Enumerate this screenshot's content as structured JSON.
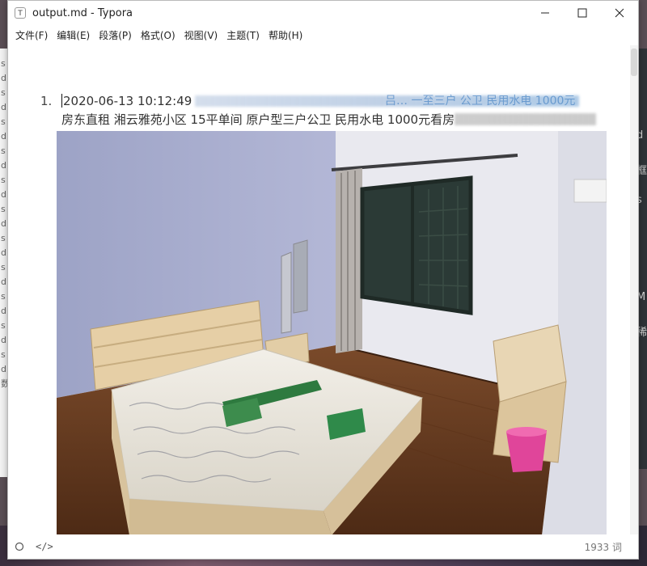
{
  "window": {
    "title": "output.md - Typora",
    "minimize_glyph": "─",
    "maximize_glyph": "☐",
    "close_glyph": "✕"
  },
  "menu": {
    "items": [
      "文件(F)",
      "编辑(E)",
      "段落(P)",
      "格式(O)",
      "视图(V)",
      "主题(T)",
      "帮助(H)"
    ]
  },
  "document": {
    "list_number": "1.",
    "line1_datetime": "2020-06-13 10:12:49",
    "line1_tail": "吕… 一至三户 公卫 民用水电 1000元",
    "line2_text": "房东直租 湘云雅苑小区 15平单间 原户型三户公卫 民用水电 1000元看房"
  },
  "statusbar": {
    "word_count": "1933 词",
    "source_toggle_icon": "</>"
  },
  "colors": {
    "wall": "#a7add0",
    "floor": "#6b3d22",
    "bed_wood": "#e6cfa6",
    "link_blue": "#4b86c6"
  }
}
